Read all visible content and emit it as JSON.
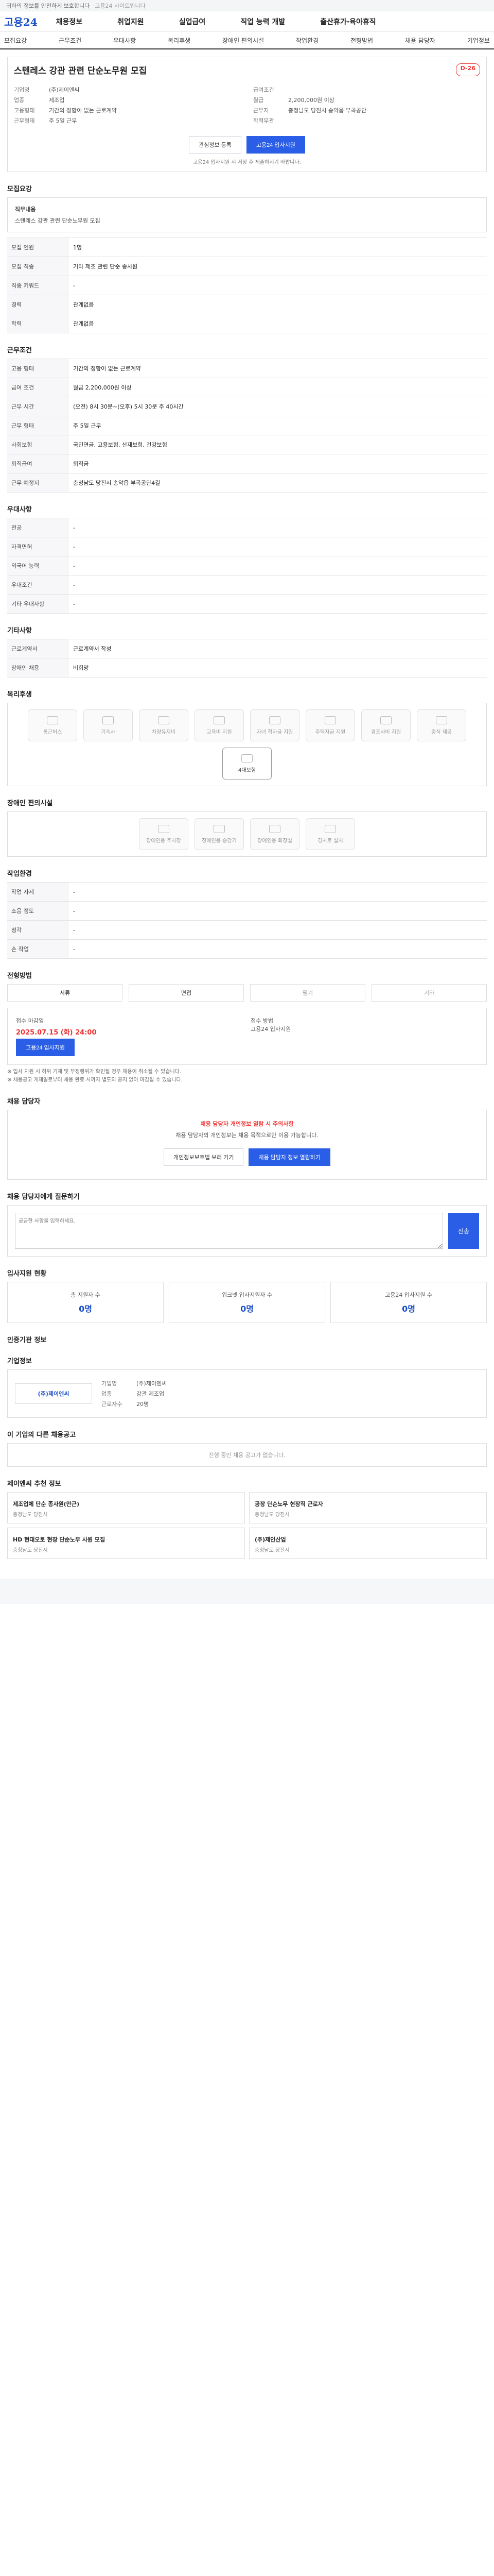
{
  "topbar": {
    "left": "귀하의 정보를 안전하게 보호합니다",
    "right": "고용24 사이트입니다"
  },
  "header": {
    "logo": "고용24",
    "nav": [
      "채용정보",
      "취업지원",
      "실업급여",
      "직업 능력 개발",
      "출산휴가·육아휴직"
    ]
  },
  "subnav": [
    "모집요강",
    "근무조건",
    "우대사항",
    "복리후생",
    "장애인 편의시설",
    "작업환경",
    "전형방법",
    "채용 담당자",
    "기업정보"
  ],
  "job": {
    "title": "스텐레스 강관 관련 단순노무원 모집",
    "dday": "D-26",
    "left": [
      {
        "k": "기업명",
        "v": "(주)제이엔씨"
      },
      {
        "k": "업종",
        "v": "제조업"
      },
      {
        "k": "고용형태",
        "v": "기간의 정함이 없는 근로계약"
      },
      {
        "k": "근무형태",
        "v": "주 5일 근무"
      }
    ],
    "right": [
      {
        "k": "급여조건",
        "v": ""
      },
      {
        "k": "월급",
        "v": "2,200,000원 이상"
      },
      {
        "k": "근무지",
        "v": "충청남도 당진시 송악읍 부곡공단"
      },
      {
        "k": "학력무관",
        "v": ""
      }
    ],
    "buttons": {
      "save": "관심정보 등록",
      "apply": "고용24 입사지원"
    },
    "note": "고용24 입사지원 시 저장 후 제출하시기 바랍니다."
  },
  "sections": {
    "recruit": "모집요강",
    "recruit_title": "직무내용",
    "recruit_text": "스텐레스 강관 관련 단순노무원 모집",
    "recruit_rows": [
      {
        "k": "모집 인원",
        "v": "1명"
      },
      {
        "k": "모집 직종",
        "v": "기타 제조 관련 단순 종사원"
      },
      {
        "k": "직종 키워드",
        "v": "-"
      },
      {
        "k": "경력",
        "v": "관계없음"
      },
      {
        "k": "학력",
        "v": "관계없음"
      }
    ],
    "conditions": "근무조건",
    "cond_rows": [
      {
        "k": "고용 형태",
        "v": "기간의 정함이 없는 근로계약"
      },
      {
        "k": "급여 조건",
        "v": "월급 2,200,000원 이상"
      },
      {
        "k": "근무 시간",
        "v": "(오전) 8시 30분~(오후) 5시 30분 주 40시간"
      },
      {
        "k": "근무 형태",
        "v": "주 5일 근무"
      },
      {
        "k": "사회보험",
        "v": "국민연금, 고용보험, 산재보험, 건강보험"
      },
      {
        "k": "퇴직급여",
        "v": "퇴직금"
      },
      {
        "k": "근무 예정지",
        "v": "충청남도 당진시 송악읍 부곡공단4길"
      }
    ],
    "prefer": "우대사항",
    "prefer_rows": [
      {
        "k": "전공",
        "v": "-"
      },
      {
        "k": "자격면허",
        "v": "-"
      },
      {
        "k": "외국어 능력",
        "v": "-"
      },
      {
        "k": "우대조건",
        "v": "-"
      },
      {
        "k": "기타 우대사항",
        "v": "-"
      }
    ],
    "etc": "기타사항",
    "etc_rows": [
      {
        "k": "근로계약서",
        "v": "근로계약서 작성"
      },
      {
        "k": "장애인 채용",
        "v": "비희망"
      }
    ],
    "welfare": "복리후생",
    "welfare_chips": [
      "통근버스",
      "기숙사",
      "차량유지비",
      "교육비 지원",
      "자녀 학자금 지원",
      "주택자금 지원",
      "경조사비 지원",
      "중식 제공",
      "4대보험"
    ],
    "disabled": "장애인 편의시설",
    "disabled_chips": [
      "장애인용 주차장",
      "장애인용 승강기",
      "장애인용 화장실",
      "경사로 설치"
    ],
    "env": "작업환경",
    "env_rows": [
      {
        "k": "작업 자세",
        "v": "-"
      },
      {
        "k": "소음 정도",
        "v": "-"
      },
      {
        "k": "청각",
        "v": "-"
      },
      {
        "k": "손 작업",
        "v": "-"
      }
    ],
    "method": "전형방법",
    "methods": [
      "서류",
      "면접",
      "필기",
      "기타"
    ],
    "apply_period_label": "접수 마감일",
    "apply_period": "2025.07.15 (화) 24:00",
    "apply_method_label": "접수 방법",
    "apply_method": "고용24 입사지원",
    "apply_button": "고용24 입사지원",
    "notes": [
      "※ 입사 지원 시 허위 기재 및 부정행위가 확인될 경우 채용이 취소될 수 있습니다.",
      "※ 채용공고 게재일로부터 채용 완료 시까지 별도의 공지 없이 마감될 수 있습니다."
    ],
    "contact": "채용 담당자",
    "contact_warn": "채용 담당자 개인정보 열람 시 주의사항",
    "contact_text": "채용 담당자의 개인정보는 채용 목적으로만 이용 가능합니다.",
    "contact_btns": [
      "개인정보보호법 보러 가기",
      "채용 담당자 정보 열람하기"
    ],
    "qa": "채용 담당자에게 질문하기",
    "qa_placeholder": "궁금한 사항을 입력하세요.",
    "qa_send": "전송",
    "stats": "입사지원 현황",
    "stat_items": [
      {
        "k": "총 지원자 수",
        "v": "0명"
      },
      {
        "k": "워크넷 입사지원자 수",
        "v": "0명"
      },
      {
        "k": "고용24 입사지원 수",
        "v": "0명"
      }
    ],
    "info": "인증기관 정보",
    "company": "기업정보",
    "company_name": "(주)제이엔씨",
    "company_rows": [
      {
        "k": "기업명",
        "v": "(주)제이엔씨"
      },
      {
        "k": "업종",
        "v": "강관 제조업"
      },
      {
        "k": "근로자수",
        "v": "20명"
      }
    ],
    "others": "이 기업의 다른 채용공고",
    "others_empty": "진행 중인 채용 공고가 없습니다.",
    "reco": "제이엔씨 추천 정보",
    "reco_items": [
      {
        "t": "제조업체 단순 종사원(만근)",
        "c": "충청남도 당진시"
      },
      {
        "t": "공장 단순노무 현장직 근로자",
        "c": "충청남도 당진시"
      },
      {
        "t": "HD 현대오토 현장 단순노무 사원 모집",
        "c": "충청남도 당진시"
      },
      {
        "t": "(주)제인산업",
        "c": "충청남도 당진시"
      }
    ]
  }
}
